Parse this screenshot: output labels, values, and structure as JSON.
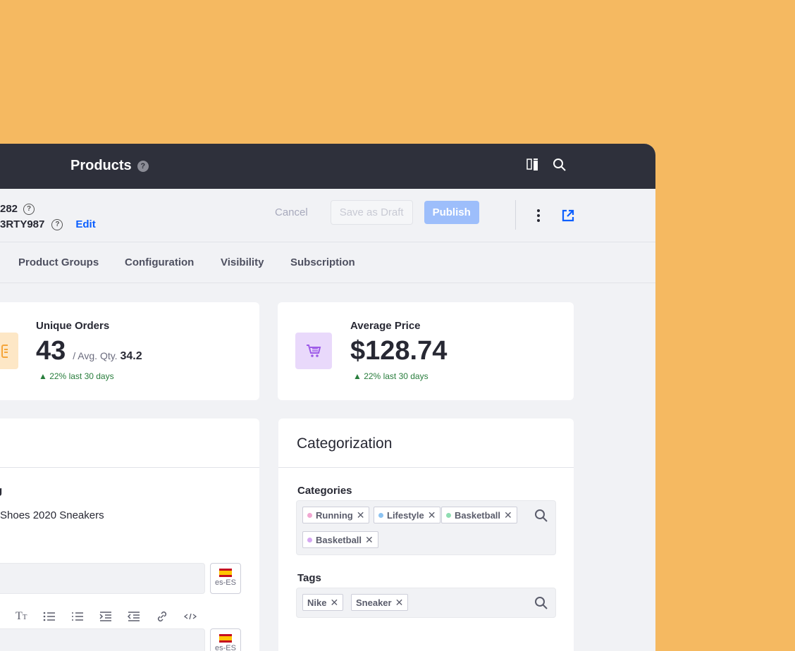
{
  "topbar": {
    "title": "Products"
  },
  "header": {
    "id_line1": "282",
    "id_line2": "3RTY987",
    "edit_label": "Edit",
    "cancel_label": "Cancel",
    "draft_label": "Save as Draft",
    "publish_label": "Publish"
  },
  "tabs": [
    "Product Groups",
    "Configuration",
    "Visibility",
    "Subscription"
  ],
  "stats": {
    "orders": {
      "label": "Unique Orders",
      "value": "43",
      "sub_prefix": "/ Avg. Qty.",
      "sub_value": "34.2",
      "trend": "▲ 22% last 30 days"
    },
    "price": {
      "label": "Average Price",
      "value": "$128.74",
      "trend": "▲ 22% last 30 days"
    }
  },
  "details": {
    "label_fragment": "g",
    "value_text": "Shoes 2020 Sneakers",
    "locale": "es-ES"
  },
  "categorization": {
    "title": "Categorization",
    "categories_label": "Categories",
    "categories": [
      {
        "label": "Running",
        "color": "#F1A7D2"
      },
      {
        "label": "Lifestyle",
        "color": "#8CC3F2"
      },
      {
        "label": "Basketball",
        "color": "#8FDDB2"
      },
      {
        "label": "Basketball",
        "color": "#D5A7F1"
      }
    ],
    "tags_label": "Tags",
    "tags": [
      "Nike",
      "Sneaker"
    ]
  },
  "colors": {
    "accent": "#0B5FFF",
    "background": "#F5B961",
    "topbar": "#2E303B"
  }
}
